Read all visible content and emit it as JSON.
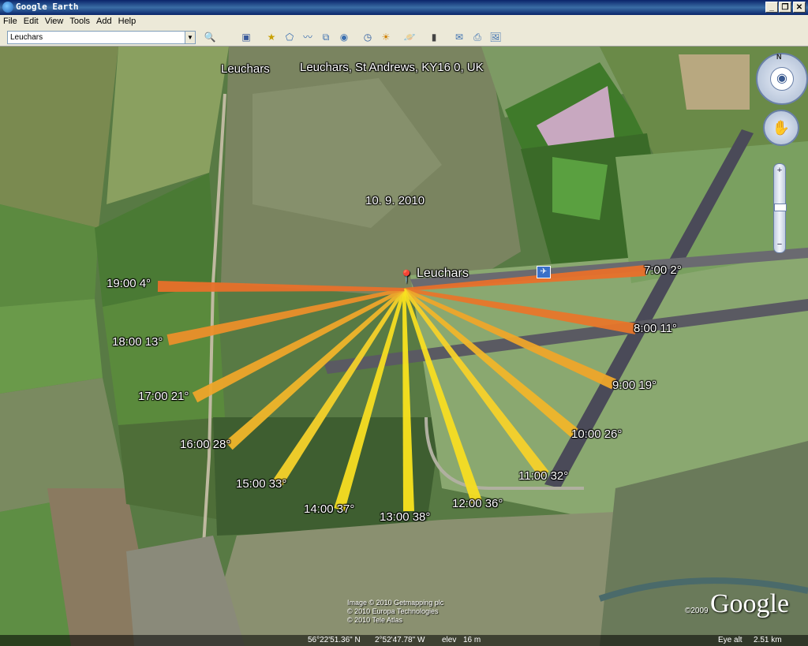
{
  "window": {
    "title": "Google Earth"
  },
  "window_buttons": [
    "_",
    "❐",
    "✕"
  ],
  "menu": [
    "File",
    "Edit",
    "View",
    "Tools",
    "Add",
    "Help"
  ],
  "search": {
    "value": "Leuchars"
  },
  "toolbar_icons": [
    "sidebar-icon",
    "placemark-icon",
    "polygon-icon",
    "path-icon",
    "image-overlay-icon",
    "record-tour-icon",
    "historical-imagery-icon",
    "sunlight-icon",
    "planets-icon",
    "ruler-icon",
    "email-icon",
    "print-icon",
    "save-image-icon"
  ],
  "map": {
    "breadcrumb_place": "Leuchars",
    "address": "Leuchars, St Andrews, KY16 0, UK",
    "date": "10. 9. 2010",
    "placemark_label": "Leuchars",
    "sun_rays": [
      {
        "time": "7:00",
        "elev": "2°",
        "color": "#e8702a"
      },
      {
        "time": "8:00",
        "elev": "11°",
        "color": "#e8762a"
      },
      {
        "time": "9:00",
        "elev": "19°",
        "color": "#eea52a"
      },
      {
        "time": "10:00",
        "elev": "26°",
        "color": "#f0b52a"
      },
      {
        "time": "11:00",
        "elev": "32°",
        "color": "#f5d12a"
      },
      {
        "time": "12:00",
        "elev": "36°",
        "color": "#f7dd22"
      },
      {
        "time": "13:00",
        "elev": "38°",
        "color": "#f9e31e"
      },
      {
        "time": "14:00",
        "elev": "37°",
        "color": "#f7dd22"
      },
      {
        "time": "15:00",
        "elev": "33°",
        "color": "#f5d12a"
      },
      {
        "time": "16:00",
        "elev": "28°",
        "color": "#f0b52a"
      },
      {
        "time": "17:00",
        "elev": "21°",
        "color": "#eea52a"
      },
      {
        "time": "18:00",
        "elev": "13°",
        "color": "#eb8f2a"
      },
      {
        "time": "19:00",
        "elev": "4°",
        "color": "#e8702a"
      }
    ],
    "credits": [
      "Image © 2010 Getmapping plc",
      "© 2010 Europa Technologies",
      "© 2010 Tele Atlas"
    ],
    "logo": "Google",
    "logo_year": "©2009",
    "status": {
      "lat": "56°22'51.36\" N",
      "lon": "2°52'47.78\" W",
      "elev_label": "elev",
      "elev": "16 m",
      "eye_label": "Eye alt",
      "eye": "2.51 km"
    },
    "compass_north": "N"
  }
}
